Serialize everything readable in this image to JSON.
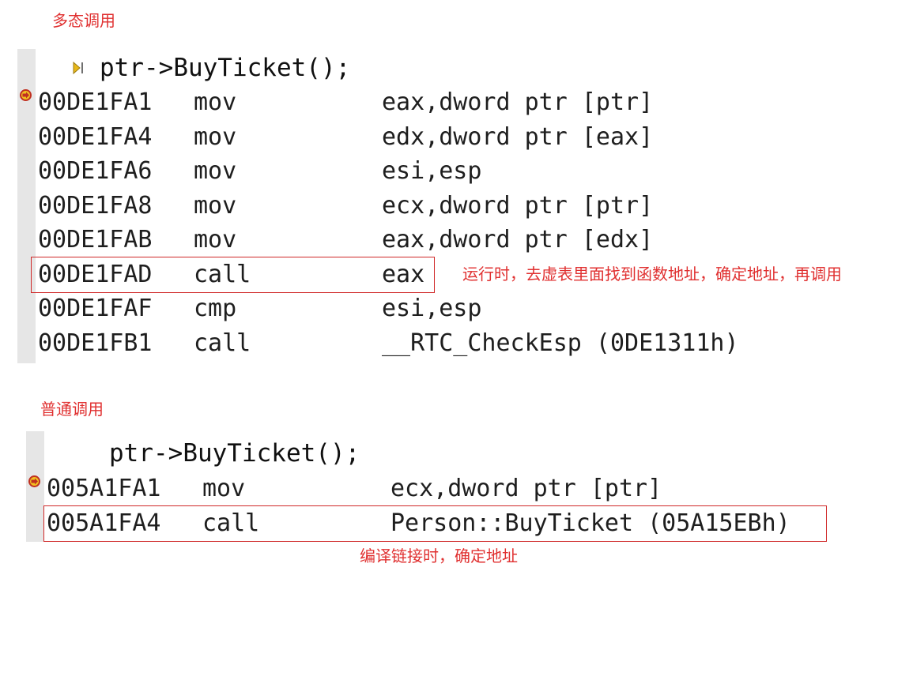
{
  "sections": [
    {
      "title": "多态调用",
      "source": "ptr->BuyTicket();",
      "instructions": [
        {
          "addr": "00DE1FA1",
          "op": "mov",
          "args": "eax,dword ptr [ptr]"
        },
        {
          "addr": "00DE1FA4",
          "op": "mov",
          "args": "edx,dword ptr [eax]"
        },
        {
          "addr": "00DE1FA6",
          "op": "mov",
          "args": "esi,esp"
        },
        {
          "addr": "00DE1FA8",
          "op": "mov",
          "args": "ecx,dword ptr [ptr]"
        },
        {
          "addr": "00DE1FAB",
          "op": "mov",
          "args": "eax,dword ptr [edx]"
        },
        {
          "addr": "00DE1FAD",
          "op": "call",
          "args": "eax"
        },
        {
          "addr": "00DE1FAF",
          "op": "cmp",
          "args": "esi,esp"
        },
        {
          "addr": "00DE1FB1",
          "op": "call",
          "args": "__RTC_CheckEsp (0DE1311h)"
        }
      ],
      "annotation": "运行时，去虚表里面找到函数地址，确定地址，再调用"
    },
    {
      "title": "普通调用",
      "source": "ptr->BuyTicket();",
      "instructions": [
        {
          "addr": "005A1FA1",
          "op": "mov",
          "args": "ecx,dword ptr [ptr]"
        },
        {
          "addr": "005A1FA4",
          "op": "call",
          "args": "Person::BuyTicket (05A15EBh)"
        }
      ],
      "annotation": "编译链接时，确定地址"
    }
  ],
  "colors": {
    "annotation": "#e03030",
    "highlight_box": "#d02828",
    "gutter": "#e6e6e6",
    "breakpoint_fill": "#e8b818",
    "breakpoint_ring": "#c03020",
    "code_text": "#1e1e1e"
  },
  "icons": {
    "breakpoint": "current-instruction-pointer-icon",
    "source_step": "step-into-source-icon"
  }
}
